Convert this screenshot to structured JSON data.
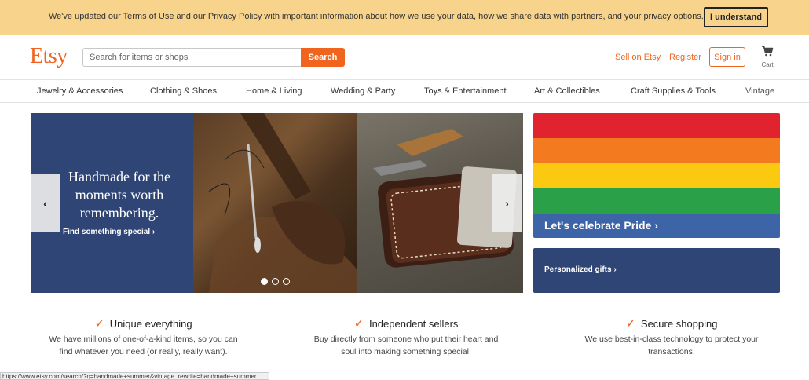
{
  "banner": {
    "text_before": "We've updated our ",
    "terms_link": "Terms of Use",
    "text_mid": " and our ",
    "privacy_link": "Privacy Policy",
    "text_after": " with important information about how we use your data, how we share data with partners, and your privacy options.",
    "button": "I understand"
  },
  "header": {
    "logo": "Etsy",
    "search_placeholder": "Search for items or shops",
    "search_button": "Search",
    "sell_link": "Sell on Etsy",
    "register_link": "Register",
    "signin_button": "Sign in",
    "cart_label": "Cart"
  },
  "categories": [
    "Jewelry & Accessories",
    "Clothing & Shoes",
    "Home & Living",
    "Wedding & Party",
    "Toys & Entertainment",
    "Art & Collectibles",
    "Craft Supplies & Tools",
    "Vintage"
  ],
  "hero": {
    "title": "Handmade for the moments worth remembering.",
    "cta": "Find something special ›",
    "prev_arrow": "‹",
    "next_arrow": "›"
  },
  "side_banners": {
    "pride": "Let's celebrate Pride ›",
    "gifts": "Personalized gifts ›",
    "pride_colors": [
      "#e0232e",
      "#f47a20",
      "#fbc90f",
      "#2aa048",
      "#3e64a8"
    ]
  },
  "value_props": [
    {
      "title": "Unique everything",
      "body": "We have millions of one-of-a-kind items, so you can find whatever you need (or really, really want)."
    },
    {
      "title": "Independent sellers",
      "body": "Buy directly from someone who put their heart and soul into making something special."
    },
    {
      "title": "Secure shopping",
      "body": "We use best-in-class technology to protect your transactions."
    }
  ],
  "status_url": "https://www.etsy.com/search/?q=handmade+summer&vintage_rewrite=handmade+summer",
  "colors": {
    "brand_orange": "#f1641e",
    "banner_yellow": "#f7d38b",
    "navy": "#2f4575"
  }
}
